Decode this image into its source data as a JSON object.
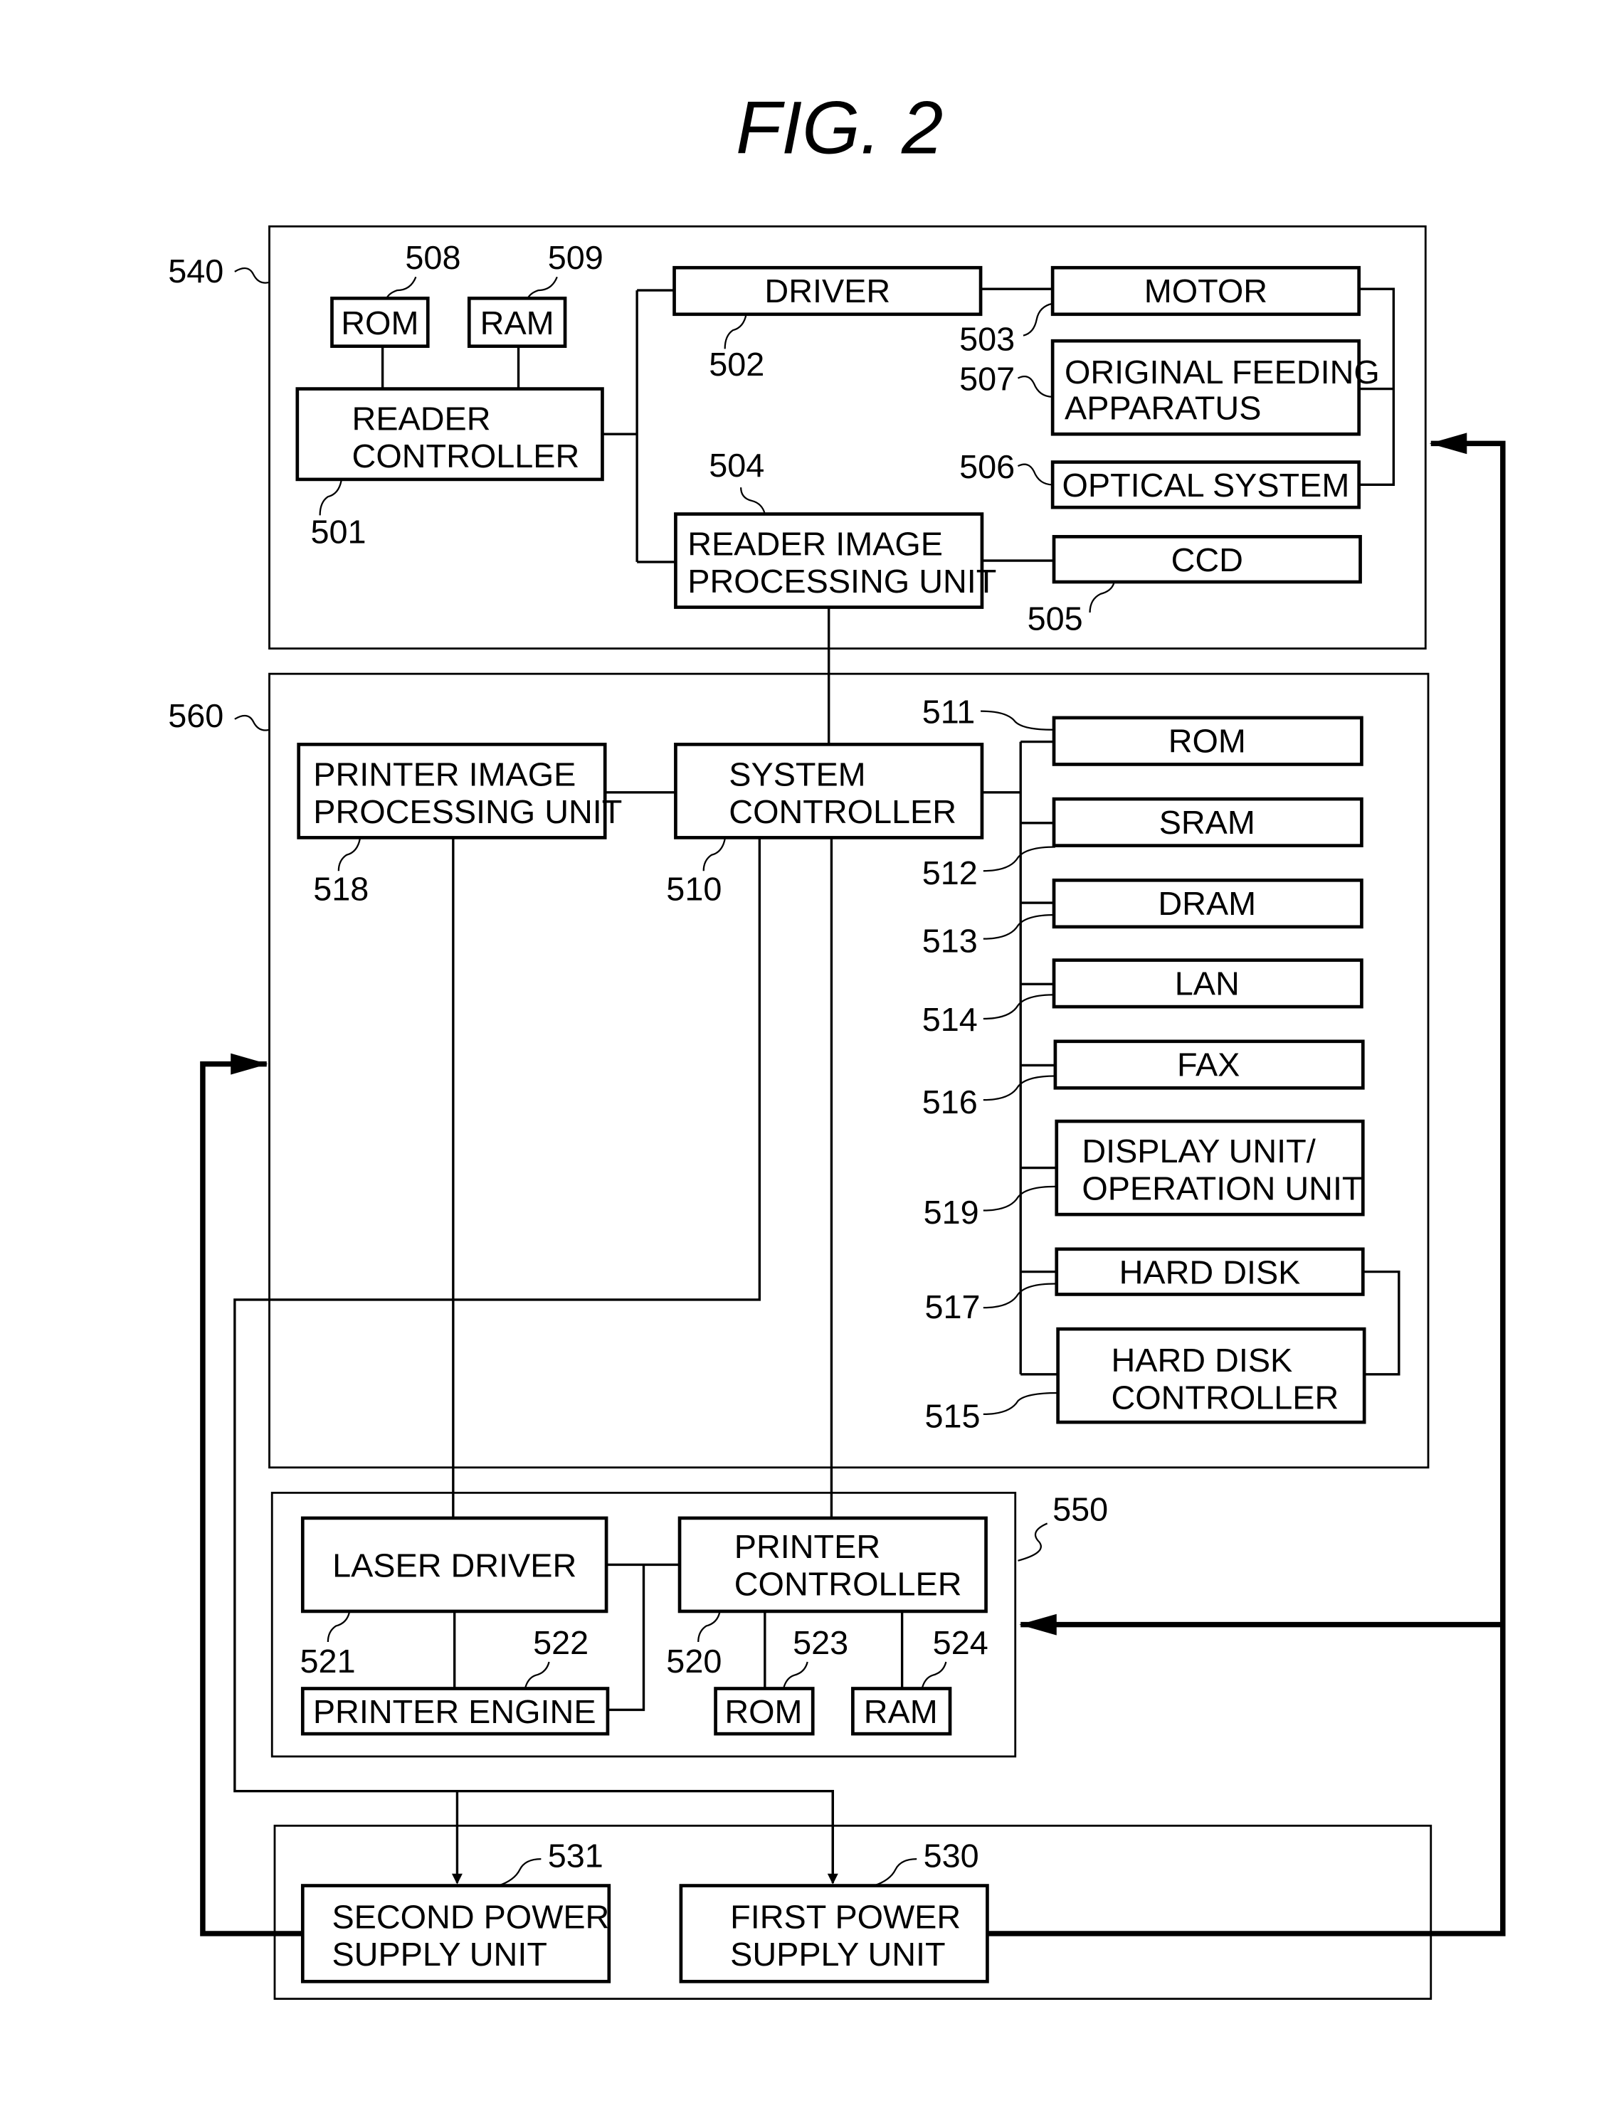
{
  "title": "FIG.  2",
  "units": {
    "u540": "540",
    "u560": "560",
    "u550": "550"
  },
  "blocks": {
    "rom508": {
      "ref": "508",
      "line1": "ROM"
    },
    "ram509": {
      "ref": "509",
      "line1": "RAM"
    },
    "reader_controller": {
      "ref": "501",
      "line1": "READER",
      "line2": "CONTROLLER"
    },
    "driver": {
      "ref": "502",
      "line1": "DRIVER"
    },
    "motor": {
      "ref": "503",
      "line1": "MOTOR"
    },
    "original_feeding": {
      "ref": "507",
      "line1": "ORIGINAL  FEEDING",
      "line2": "APPARATUS"
    },
    "optical_system": {
      "ref": "506",
      "line1": "OPTICAL  SYSTEM"
    },
    "reader_image": {
      "ref": "504",
      "line1": "READER  IMAGE",
      "line2": "PROCESSING  UNIT"
    },
    "ccd": {
      "ref": "505",
      "line1": "CCD"
    },
    "printer_image": {
      "ref": "518",
      "line1": "PRINTER  IMAGE",
      "line2": "PROCESSING  UNIT"
    },
    "system_controller": {
      "ref": "510",
      "line1": "SYSTEM",
      "line2": "CONTROLLER"
    },
    "rom511": {
      "ref": "511",
      "line1": "ROM"
    },
    "sram": {
      "ref": "512",
      "line1": "SRAM"
    },
    "dram": {
      "ref": "513",
      "line1": "DRAM"
    },
    "lan": {
      "ref": "514",
      "line1": "LAN"
    },
    "fax": {
      "ref": "516",
      "line1": "FAX"
    },
    "display": {
      "ref": "519",
      "line1": "DISPLAY  UNIT/",
      "line2": "OPERATION  UNIT"
    },
    "hard_disk": {
      "ref": "517",
      "line1": "HARD  DISK"
    },
    "hdc": {
      "ref": "515",
      "line1": "HARD  DISK",
      "line2": "CONTROLLER"
    },
    "laser_driver": {
      "ref": "521",
      "line1": "LASER  DRIVER"
    },
    "printer_controller": {
      "ref": "520",
      "line1": "PRINTER",
      "line2": "CONTROLLER"
    },
    "printer_engine": {
      "ref": "522",
      "line1": "PRINTER  ENGINE"
    },
    "rom523": {
      "ref": "523",
      "line1": "ROM"
    },
    "ram524": {
      "ref": "524",
      "line1": "RAM"
    },
    "second_power": {
      "ref": "531",
      "line1": "SECOND  POWER",
      "line2": "SUPPLY  UNIT"
    },
    "first_power": {
      "ref": "530",
      "line1": "FIRST  POWER",
      "line2": "SUPPLY  UNIT"
    }
  }
}
